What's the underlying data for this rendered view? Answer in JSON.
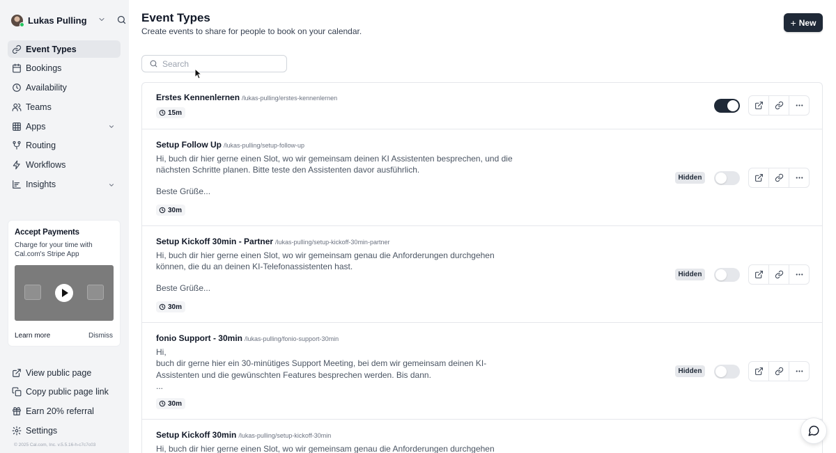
{
  "user": {
    "name": "Lukas Pulling"
  },
  "nav": {
    "items": [
      {
        "label": "Event Types",
        "icon": "link-icon",
        "active": true
      },
      {
        "label": "Bookings",
        "icon": "calendar-icon"
      },
      {
        "label": "Availability",
        "icon": "clock-icon"
      },
      {
        "label": "Teams",
        "icon": "users-icon"
      },
      {
        "label": "Apps",
        "icon": "grid-icon",
        "expandable": true
      },
      {
        "label": "Routing",
        "icon": "git-merge-icon"
      },
      {
        "label": "Workflows",
        "icon": "zap-icon"
      },
      {
        "label": "Insights",
        "icon": "bar-chart-icon",
        "expandable": true
      }
    ]
  },
  "promo": {
    "title": "Accept Payments",
    "description": "Charge for your time with Cal.com's Stripe App",
    "learn_more": "Learn more",
    "dismiss": "Dismiss"
  },
  "bottom_nav": {
    "items": [
      {
        "label": "View public page",
        "icon": "external-link-icon"
      },
      {
        "label": "Copy public page link",
        "icon": "copy-icon"
      },
      {
        "label": "Earn 20% referral",
        "icon": "gift-icon"
      },
      {
        "label": "Settings",
        "icon": "settings-icon"
      }
    ]
  },
  "copyright": "© 2025 Cal.com, Inc. v.5.5.16-h-c7c7c03",
  "header": {
    "title": "Event Types",
    "subtitle": "Create events to share for people to book on your calendar.",
    "new_button": "New"
  },
  "search": {
    "placeholder": "Search",
    "value": ""
  },
  "event_types": [
    {
      "title": "Erstes Kennenlernen",
      "slug": "/lukas-pulling/erstes-kennenlernen",
      "description": "",
      "extra": "",
      "duration": "15m",
      "hidden": false,
      "enabled": true
    },
    {
      "title": "Setup Follow Up",
      "slug": "/lukas-pulling/setup-follow-up",
      "description": "Hi, buch dir hier gerne einen Slot, wo wir gemeinsam deinen KI Assistenten besprechen, und die nächsten Schritte planen. Bitte teste den Assistenten davor ausführlich.",
      "extra": "Beste Grüße...",
      "duration": "30m",
      "hidden": true,
      "hidden_label": "Hidden",
      "enabled": false
    },
    {
      "title": "Setup Kickoff 30min - Partner",
      "slug": "/lukas-pulling/setup-kickoff-30min-partner",
      "description": "Hi, buch dir hier gerne einen Slot, wo wir gemeinsam genau die Anforderungen durchgehen können, die du an deinen KI-Telefonassistenten hast.",
      "extra": "Beste Grüße...",
      "duration": "30m",
      "hidden": true,
      "hidden_label": "Hidden",
      "enabled": false
    },
    {
      "title": "fonio Support - 30min",
      "slug": "/lukas-pulling/fonio-support-30min",
      "description": "Hi,\nbuch dir gerne hier ein 30-minütiges Support Meeting, bei dem wir gemeinsam deinen KI-Assistenten und die gewünschten Features besprechen werden. Bis dann.\n...",
      "extra": "",
      "duration": "30m",
      "hidden": true,
      "hidden_label": "Hidden",
      "enabled": false
    },
    {
      "title": "Setup Kickoff 30min",
      "slug": "/lukas-pulling/setup-kickoff-30min",
      "description": "Hi, buch dir hier gerne einen Slot, wo wir gemeinsam genau die Anforderungen durchgehen",
      "extra": "",
      "duration": "",
      "hidden": false,
      "enabled": false
    }
  ]
}
